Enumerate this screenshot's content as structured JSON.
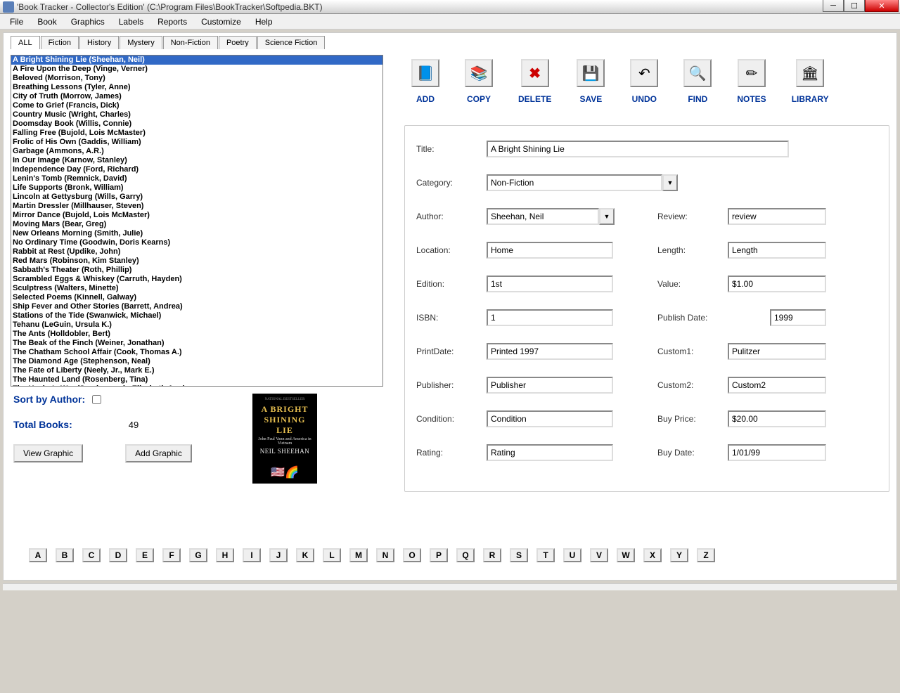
{
  "window": {
    "title": "'Book Tracker - Collector's Edition'     (C:\\Program Files\\BookTracker\\Softpedia.BKT)"
  },
  "menu": [
    "File",
    "Book",
    "Graphics",
    "Labels",
    "Reports",
    "Customize",
    "Help"
  ],
  "tabs": [
    "ALL",
    "Fiction",
    "History",
    "Mystery",
    "Non-Fiction",
    "Poetry",
    "Science Fiction"
  ],
  "active_tab": 0,
  "books": [
    "A Bright Shining Lie (Sheehan, Neil)",
    "A Fire Upon the Deep (Vinge, Verner)",
    "Beloved (Morrison, Tony)",
    "Breathing Lessons (Tyler, Anne)",
    "City of Truth (Morrow, James)",
    "Come to Grief (Francis, Dick)",
    "Country Music (Wright, Charles)",
    "Doomsday Book (Willis, Connie)",
    "Falling Free (Bujold, Lois McMaster)",
    "Frolic of His Own (Gaddis, William)",
    "Garbage (Ammons, A.R.)",
    "In Our Image (Karnow, Stanley)",
    "Independence Day (Ford, Richard)",
    "Lenin's Tomb (Remnick, David)",
    "Life Supports (Bronk, William)",
    "Lincoln at Gettysburg (Wills, Garry)",
    "Martin Dressler (Millhauser, Steven)",
    "Mirror Dance (Bujold, Lois McMaster)",
    "Moving Mars (Bear, Greg)",
    "New Orleans Morning (Smith, Julie)",
    "No Ordinary Time (Goodwin, Doris Kearns)",
    "Rabbit at Rest (Updike, John)",
    "Red Mars (Robinson, Kim Stanley)",
    "Sabbath's Theater (Roth, Phillip)",
    "Scrambled Eggs & Whiskey (Carruth, Hayden)",
    "Sculptress (Walters, Minette)",
    "Selected Poems (Kinnell, Galway)",
    "Ship Fever and Other Stories (Barrett, Andrea)",
    "Stations of the Tide (Swanwick, Michael)",
    "Tehanu (LeGuin, Ursula K.)",
    "The Ants (Holldobler, Bert)",
    "The Beak of the Finch (Weiner, Jonathan)",
    "The Chatham School Affair (Cook, Thomas A.)",
    "The Diamond Age (Stephenson, Neal)",
    "The Fate of Liberty (Neely, Jr., Mark E.)",
    "The Haunted Land (Rosenberg, Tina)",
    "The Healer's War (Scarborough, Elizabeth Ann)"
  ],
  "selected_book": 0,
  "sort": {
    "label": "Sort by Author:",
    "checked": false
  },
  "total": {
    "label": "Total Books:",
    "value": "49"
  },
  "graphic_buttons": {
    "view": "View Graphic",
    "add": "Add Graphic"
  },
  "cover": {
    "line1": "A BRIGHT",
    "line2": "SHINING LIE",
    "sub": "John Paul Vann and America in Vietnam",
    "author": "NEIL SHEEHAN"
  },
  "toolbar": [
    {
      "label": "ADD",
      "icon": "📘"
    },
    {
      "label": "COPY",
      "icon": "📚"
    },
    {
      "label": "DELETE",
      "icon": "✖"
    },
    {
      "label": "SAVE",
      "icon": "💾"
    },
    {
      "label": "UNDO",
      "icon": "↶"
    },
    {
      "label": "FIND",
      "icon": "🔍"
    },
    {
      "label": "NOTES",
      "icon": "✏"
    },
    {
      "label": "LIBRARY",
      "icon": "🏛"
    }
  ],
  "form": {
    "title": {
      "label": "Title:",
      "value": "A Bright Shining Lie"
    },
    "category": {
      "label": "Category:",
      "value": "Non-Fiction"
    },
    "author": {
      "label": "Author:",
      "value": "Sheehan, Neil"
    },
    "review": {
      "label": "Review:",
      "value": "review"
    },
    "location": {
      "label": "Location:",
      "value": "Home"
    },
    "length": {
      "label": "Length:",
      "value": "Length"
    },
    "edition": {
      "label": "Edition:",
      "value": "1st"
    },
    "value_field": {
      "label": "Value:",
      "value": "$1.00"
    },
    "isbn": {
      "label": "ISBN:",
      "value": "1"
    },
    "publish_date": {
      "label": "Publish Date:",
      "value": "1999"
    },
    "print_date": {
      "label": "PrintDate:",
      "value": "Printed 1997"
    },
    "custom1": {
      "label": "Custom1:",
      "value": "Pulitzer"
    },
    "publisher": {
      "label": "Publisher:",
      "value": "Publisher"
    },
    "custom2": {
      "label": "Custom2:",
      "value": "Custom2"
    },
    "condition": {
      "label": "Condition:",
      "value": "Condition"
    },
    "buy_price": {
      "label": "Buy Price:",
      "value": "$20.00"
    },
    "rating": {
      "label": "Rating:",
      "value": "Rating"
    },
    "buy_date": {
      "label": "Buy Date:",
      "value": "1/01/99"
    }
  },
  "alphabet": [
    "A",
    "B",
    "C",
    "D",
    "E",
    "F",
    "G",
    "H",
    "I",
    "J",
    "K",
    "L",
    "M",
    "N",
    "O",
    "P",
    "Q",
    "R",
    "S",
    "T",
    "U",
    "V",
    "W",
    "X",
    "Y",
    "Z"
  ]
}
